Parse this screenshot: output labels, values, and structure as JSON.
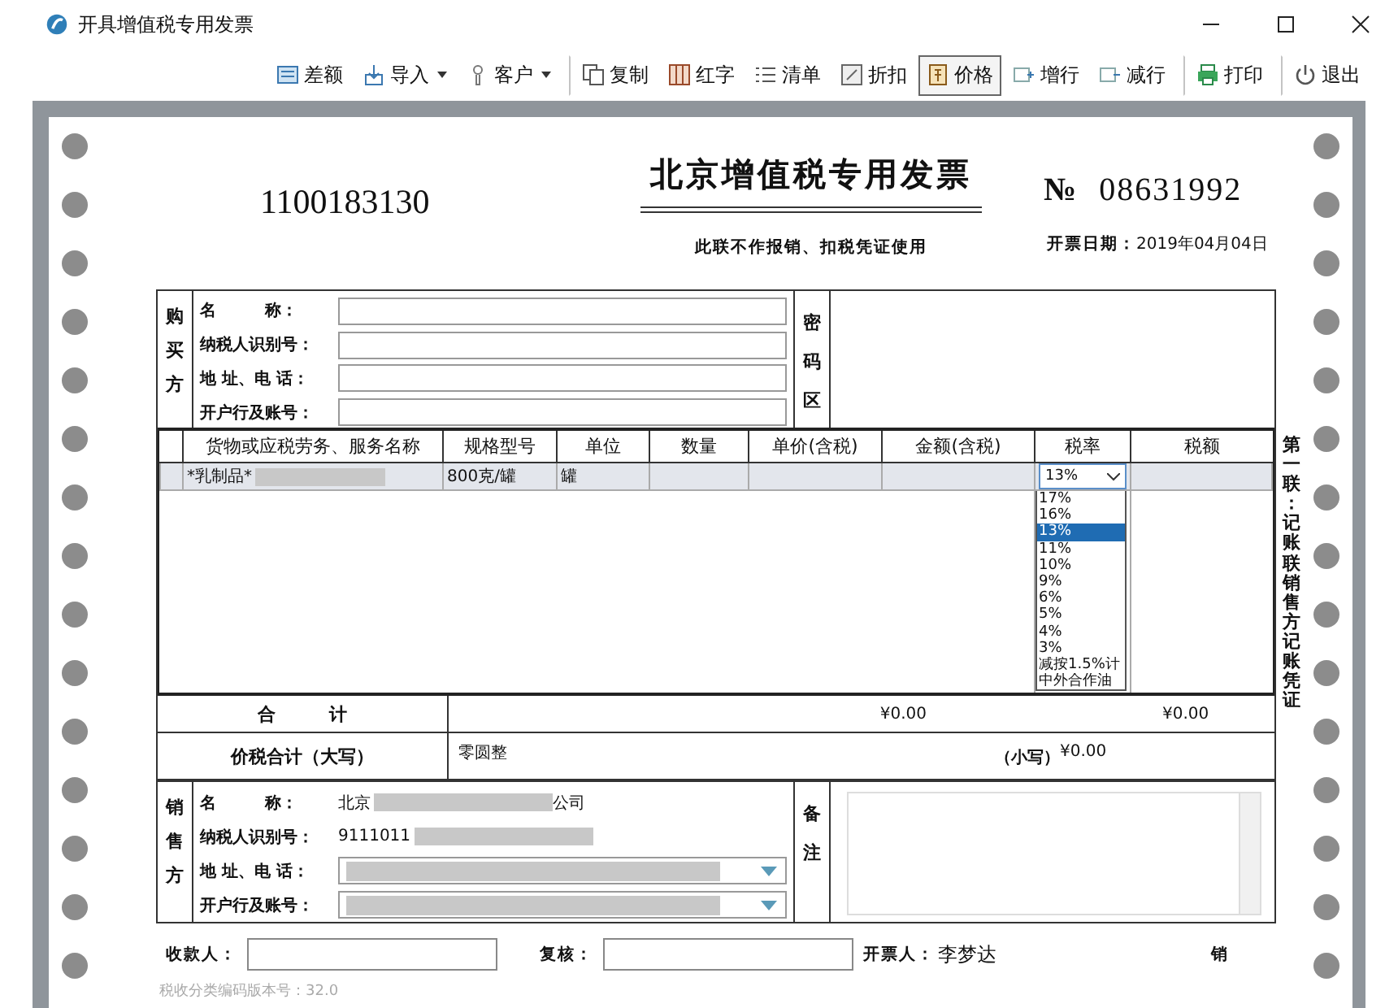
{
  "window": {
    "title": "开具增值税专用发票"
  },
  "toolbar": [
    {
      "label": "差额",
      "kind": "calc",
      "has_menu": false,
      "selected": false,
      "separator_before": false
    },
    {
      "label": "导入",
      "kind": "import",
      "has_menu": true,
      "selected": false,
      "separator_before": false
    },
    {
      "label": "客户",
      "kind": "person",
      "has_menu": true,
      "selected": false,
      "separator_before": false
    },
    {
      "label": "复制",
      "kind": "copy",
      "has_menu": false,
      "selected": false,
      "separator_before": true
    },
    {
      "label": "红字",
      "kind": "red",
      "has_menu": false,
      "selected": false,
      "separator_before": false
    },
    {
      "label": "清单",
      "kind": "list",
      "has_menu": false,
      "selected": false,
      "separator_before": false
    },
    {
      "label": "折扣",
      "kind": "discount",
      "has_menu": false,
      "selected": false,
      "separator_before": false
    },
    {
      "label": "价格",
      "kind": "price",
      "has_menu": false,
      "selected": true,
      "separator_before": false
    },
    {
      "label": "增行",
      "kind": "addrow",
      "has_menu": false,
      "selected": false,
      "separator_before": false
    },
    {
      "label": "减行",
      "kind": "delrow",
      "has_menu": false,
      "selected": false,
      "separator_before": false
    },
    {
      "label": "打印",
      "kind": "print",
      "has_menu": false,
      "selected": false,
      "separator_before": true
    },
    {
      "label": "退出",
      "kind": "power",
      "has_menu": false,
      "selected": false,
      "separator_before": true
    }
  ],
  "invoice": {
    "code": "1100183130",
    "title": "北京增值税专用发票",
    "number_sign": "№",
    "number": "08631992",
    "note": "此联不作报销、扣税凭证使用",
    "date_label": "开票日期：",
    "date": "2019年04月04日"
  },
  "buyer": {
    "side_label": "购买方",
    "fields": [
      {
        "label": "名　　　称："
      },
      {
        "label": "纳税人识别号："
      },
      {
        "label": "地 址、电 话："
      },
      {
        "label": "开户行及账号："
      }
    ],
    "password_label": "密码区"
  },
  "items": {
    "columns": [
      "货物或应税劳务、服务名称",
      "规格型号",
      "单位",
      "数量",
      "单价(含税)",
      "金额(含税)",
      "税率",
      "税额"
    ],
    "rows": [
      {
        "name": "*乳制品*",
        "name_redacted": true,
        "spec": "800克/罐",
        "unit": "罐",
        "rate": "13%"
      }
    ],
    "rate_dropdown": {
      "expanded": true,
      "options": [
        {
          "label": "17%",
          "selected": false
        },
        {
          "label": "16%",
          "selected": false
        },
        {
          "label": "13%",
          "selected": true
        },
        {
          "label": "11%",
          "selected": false
        },
        {
          "label": "10%",
          "selected": false
        },
        {
          "label": "9%",
          "selected": false
        },
        {
          "label": "6%",
          "selected": false
        },
        {
          "label": "5%",
          "selected": false
        },
        {
          "label": "4%",
          "selected": false
        },
        {
          "label": "3%",
          "selected": false
        },
        {
          "label": "减按1.5%计",
          "selected": false
        },
        {
          "label": "中外合作油",
          "selected": false
        }
      ]
    }
  },
  "totals": {
    "label": "合　　　计",
    "amount": "¥0.00",
    "tax": "¥0.00"
  },
  "grand_total": {
    "label": "价税合计（大写）",
    "words": "零圆整",
    "small_label": "（小写）",
    "small": "¥0.00"
  },
  "seller": {
    "side_label": "销售方",
    "fields": [
      {
        "label": "名　　　称：",
        "kind": "text",
        "value": "北京",
        "redacted": true,
        "value_end": "公司"
      },
      {
        "label": "纳税人识别号：",
        "kind": "text",
        "value": "9111011",
        "redacted": true
      },
      {
        "label": "地 址、电 话：",
        "kind": "select",
        "redacted": true
      },
      {
        "label": "开户行及账号：",
        "kind": "select",
        "redacted": true
      }
    ],
    "remarks_label": "备注"
  },
  "side_note": "第一联：记账联销售方记账凭证",
  "footer": {
    "payee_label": "收款人：",
    "reviewer_label": "复核：",
    "drawer_label": "开票人：",
    "drawer": "李梦达",
    "seller_sign": "销",
    "version": "税收分类编码版本号：32.0"
  }
}
